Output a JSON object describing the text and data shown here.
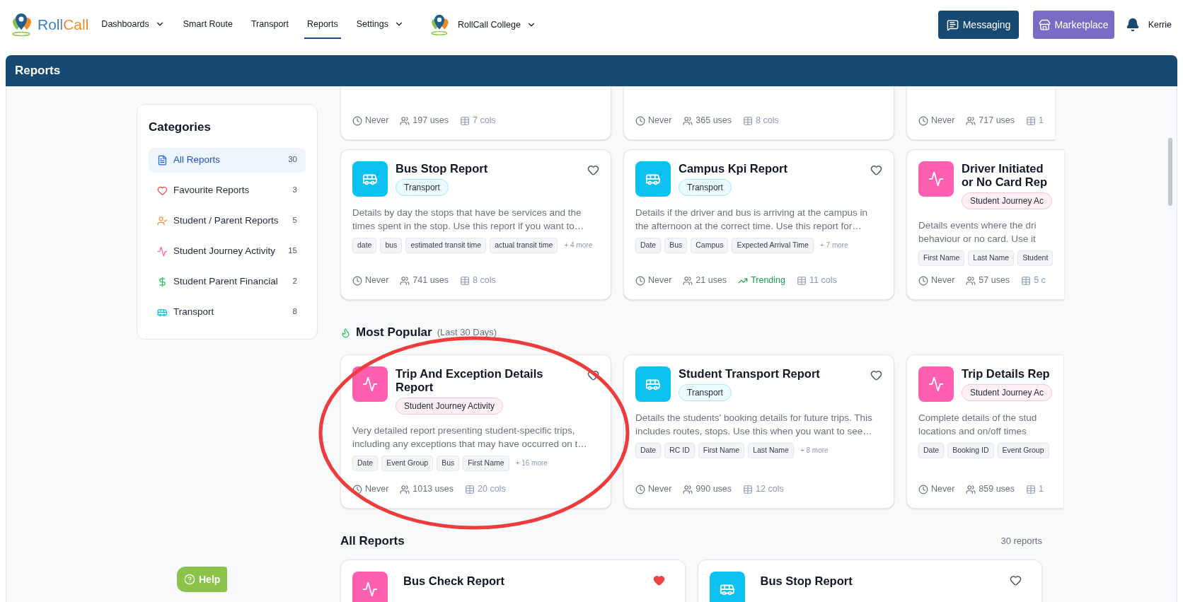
{
  "nav": {
    "logo": "RollCall",
    "items": [
      {
        "label": "Dashboards",
        "dropdown": true,
        "selected": false
      },
      {
        "label": "Smart Route",
        "dropdown": false,
        "selected": false
      },
      {
        "label": "Transport",
        "dropdown": false,
        "selected": false
      },
      {
        "label": "Reports",
        "dropdown": false,
        "selected": true
      },
      {
        "label": "Settings",
        "dropdown": true,
        "selected": false
      }
    ],
    "org": "RollCall College",
    "messaging": "Messaging",
    "marketplace": "Marketplace",
    "user": "Kerrie"
  },
  "page_title": "Reports",
  "categories": {
    "title": "Categories",
    "items": [
      {
        "label": "All Reports",
        "count": "30",
        "selected": true
      },
      {
        "label": "Favourite Reports",
        "count": "3",
        "selected": false
      },
      {
        "label": "Student / Parent Reports",
        "count": "5",
        "selected": false
      },
      {
        "label": "Student Journey Activity",
        "count": "15",
        "selected": false
      },
      {
        "label": "Student Parent Financial",
        "count": "2",
        "selected": false
      },
      {
        "label": "Transport",
        "count": "8",
        "selected": false
      }
    ]
  },
  "top_row": [
    {
      "last_run": "Never",
      "uses": "197 uses",
      "cols": "7 cols"
    },
    {
      "last_run": "Never",
      "uses": "365 uses",
      "cols": "8 cols"
    },
    {
      "last_run": "Never",
      "uses": "717 uses",
      "cols": "1"
    }
  ],
  "cards": [
    {
      "kind": "transport",
      "title_lines": [
        "Bus Stop Report"
      ],
      "badge": "Transport",
      "favourite": false,
      "description_lines": [
        "Details by day the stops that have be services and the",
        "times spent in the stop. Use this report if you want to…"
      ],
      "tags": [
        "date",
        "bus",
        "estimated transit time",
        "actual transit time"
      ],
      "more": "+ 4 more",
      "last_run": "Never",
      "uses": "741 uses",
      "cols": "8 cols"
    },
    {
      "kind": "transport",
      "title_lines": [
        "Campus Kpi Report"
      ],
      "badge": "Transport",
      "favourite": false,
      "description_lines": [
        "Details if the driver and bus is arriving at the campus in",
        "the afternoon at the correct time. Use this report for…"
      ],
      "tags": [
        "Date",
        "Bus",
        "Campus",
        "Expected Arrival Time"
      ],
      "more": "+ 7 more",
      "last_run": "Never",
      "uses": "21 uses",
      "trending": "Trending",
      "cols": "11 cols"
    },
    {
      "kind": "activity",
      "title_lines": [
        "Driver Initiated",
        "or No Card Rep"
      ],
      "badge": "Student Journey Ac",
      "description_lines": [
        "Details events where the dri",
        "behaviour or no card. Use it"
      ],
      "tags": [
        "First Name",
        "Last Name",
        "Student"
      ],
      "last_run": "Never",
      "uses": "57 uses",
      "cols": "5 c"
    }
  ],
  "most_popular": {
    "title": "Most Popular",
    "subtitle": "(Last 30 Days)",
    "cards": [
      {
        "kind": "activity",
        "title_lines": [
          "Trip And Exception Details",
          "Report"
        ],
        "badge": "Student Journey Activity",
        "favourite": false,
        "description_lines": [
          "Very detailed report presenting student-specific trips,",
          "including any exceptions that may have occurred on t…"
        ],
        "tags": [
          "Date",
          "Event Group",
          "Bus",
          "First Name"
        ],
        "more": "+ 16 more",
        "last_run": "Never",
        "uses": "1013 uses",
        "cols": "20 cols"
      },
      {
        "kind": "transport",
        "title_lines": [
          "Student Transport Report"
        ],
        "badge": "Transport",
        "favourite": false,
        "description_lines": [
          "Details the students' booking details for future trips. This",
          "includes routes, stops. Use this when you want to see…"
        ],
        "tags": [
          "Date",
          "RC ID",
          "First Name",
          "Last Name"
        ],
        "more": "+ 8 more",
        "last_run": "Never",
        "uses": "990 uses",
        "cols": "12 cols"
      },
      {
        "kind": "activity",
        "title_lines": [
          "Trip Details Rep"
        ],
        "badge": "Student Journey Ac",
        "description_lines": [
          "Complete details of the stud",
          "locations and on/off times"
        ],
        "tags": [
          "Date",
          "Booking ID",
          "Event Group"
        ],
        "last_run": "Never",
        "uses": "859 uses",
        "cols": "1"
      }
    ]
  },
  "all_reports": {
    "title": "All Reports",
    "count": "30 reports",
    "cards": [
      {
        "kind": "activity",
        "title": "Bus Check Report",
        "favourite": true
      },
      {
        "kind": "transport",
        "title": "Bus Stop Report",
        "favourite": false
      }
    ]
  },
  "help": "Help"
}
